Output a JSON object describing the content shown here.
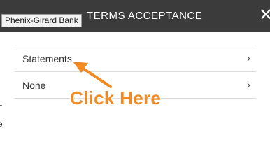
{
  "window": {
    "title": "TERMS ACCEPTANCE",
    "close_glyph": "✕"
  },
  "tooltip": {
    "text": "Phenix-Girard Bank"
  },
  "menu": {
    "items": [
      {
        "label": "Statements",
        "chevron": "›"
      },
      {
        "label": "None",
        "chevron": "›"
      }
    ]
  },
  "annotation": {
    "text": "Click Here",
    "color": "#f08a24"
  },
  "colors": {
    "header_bg": "#3b3b3b",
    "divider": "#dddddd"
  },
  "partial": {
    "left_edge_text": "e"
  }
}
